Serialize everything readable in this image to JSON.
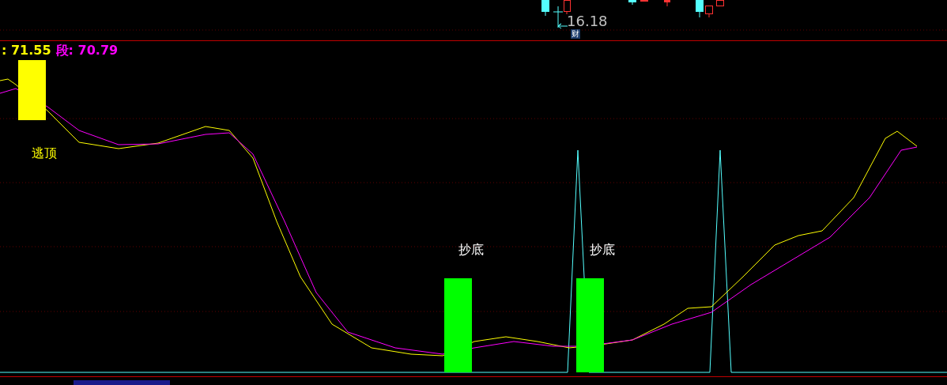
{
  "price_pane": {
    "price_label": "16.18",
    "event_tag": "财"
  },
  "indicator_pane": {
    "legend": [
      {
        "text": ": 71.55",
        "color": "#ffff00"
      },
      {
        "text": "段: 70.79",
        "color": "#ff00ff"
      }
    ],
    "signals": [
      {
        "kind": "top",
        "label": "逃顶"
      },
      {
        "kind": "bottom",
        "label": "抄底"
      },
      {
        "kind": "bottom",
        "label": "抄底"
      }
    ]
  }
}
